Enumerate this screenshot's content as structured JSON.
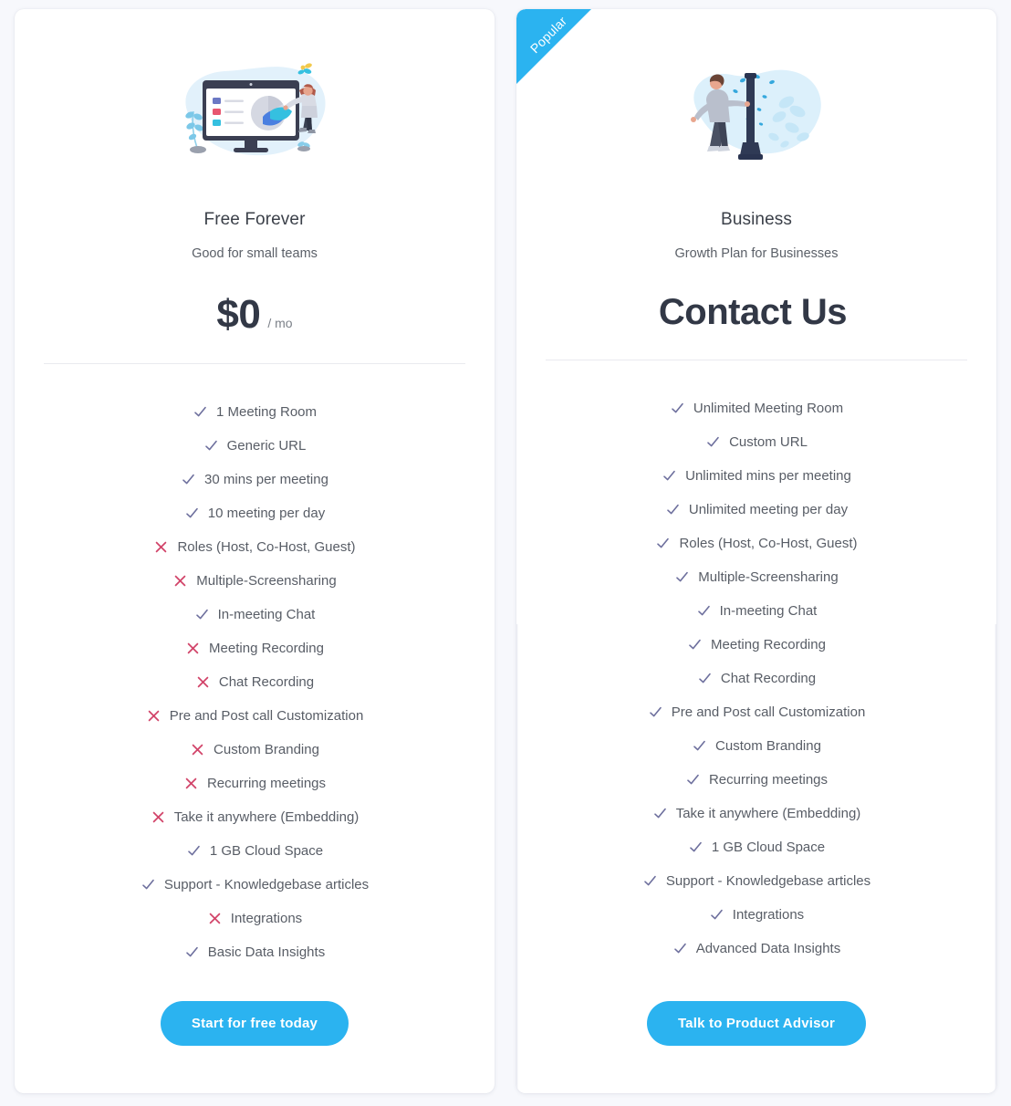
{
  "page": {
    "background_color": "#f7f8fc",
    "accent_color": "#2bb3f0",
    "check_color": "#6d6f9d",
    "cross_color": "#d2456a"
  },
  "plans": [
    {
      "id": "free",
      "name": "Free Forever",
      "tagline": "Good for small teams",
      "price": "$0",
      "price_unit": "/ mo",
      "cta_label": "Start for free today",
      "ribbon": null,
      "illustration": "dashboard-analytics-illustration",
      "features": [
        {
          "label": "1 Meeting Room",
          "included": true
        },
        {
          "label": "Generic URL",
          "included": true
        },
        {
          "label": "30 mins per meeting",
          "included": true
        },
        {
          "label": "10 meeting per day",
          "included": true
        },
        {
          "label": "Roles (Host, Co-Host, Guest)",
          "included": false
        },
        {
          "label": "Multiple-Screensharing",
          "included": false
        },
        {
          "label": "In-meeting Chat",
          "included": true
        },
        {
          "label": "Meeting Recording",
          "included": false
        },
        {
          "label": "Chat Recording",
          "included": false
        },
        {
          "label": "Pre and Post call Customization",
          "included": false
        },
        {
          "label": "Custom Branding",
          "included": false
        },
        {
          "label": "Recurring meetings",
          "included": false
        },
        {
          "label": "Take it anywhere (Embedding)",
          "included": false
        },
        {
          "label": "1 GB Cloud Space",
          "included": true
        },
        {
          "label": "Support - Knowledgebase articles",
          "included": true
        },
        {
          "label": "Integrations",
          "included": false
        },
        {
          "label": "Basic Data Insights",
          "included": true
        }
      ]
    },
    {
      "id": "business",
      "name": "Business",
      "tagline": "Growth Plan for Businesses",
      "price": "Contact Us",
      "price_unit": "",
      "cta_label": "Talk to Product Advisor",
      "ribbon": "Popular",
      "illustration": "person-streetlamp-illustration",
      "features": [
        {
          "label": "Unlimited Meeting Room",
          "included": true
        },
        {
          "label": "Custom URL",
          "included": true
        },
        {
          "label": "Unlimited mins per meeting",
          "included": true
        },
        {
          "label": "Unlimited meeting per day",
          "included": true
        },
        {
          "label": "Roles (Host, Co-Host, Guest)",
          "included": true
        },
        {
          "label": "Multiple-Screensharing",
          "included": true
        },
        {
          "label": "In-meeting Chat",
          "included": true
        },
        {
          "label": "Meeting Recording",
          "included": true
        },
        {
          "label": "Chat Recording",
          "included": true
        },
        {
          "label": "Pre and Post call Customization",
          "included": true
        },
        {
          "label": "Custom Branding",
          "included": true
        },
        {
          "label": "Recurring meetings",
          "included": true
        },
        {
          "label": "Take it anywhere (Embedding)",
          "included": true
        },
        {
          "label": "1 GB Cloud Space",
          "included": true
        },
        {
          "label": "Support - Knowledgebase articles",
          "included": true
        },
        {
          "label": "Integrations",
          "included": true
        },
        {
          "label": "Advanced Data Insights",
          "included": true
        }
      ]
    }
  ]
}
